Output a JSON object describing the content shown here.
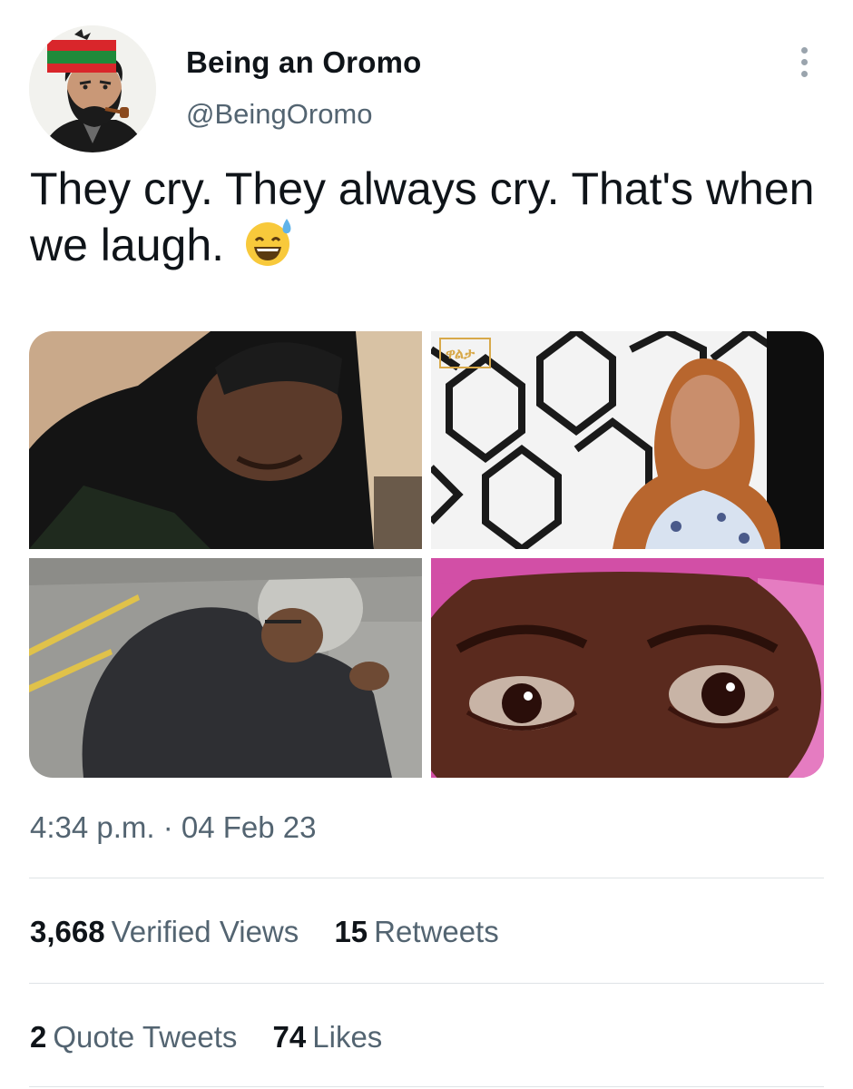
{
  "author": {
    "name": "Being an Oromo",
    "handle": "@BeingOromo"
  },
  "tweet": {
    "text": "They cry. They always cry. That's when we laugh.",
    "emoji": "grinning-face-with-sweat",
    "timestamp": "4:34 p.m. · 04 Feb 23"
  },
  "media": {
    "images": [
      {
        "description": "man crying, head bowed"
      },
      {
        "description": "woman tearful in studio"
      },
      {
        "description": "elderly man sitting on pavement covering his face"
      },
      {
        "description": "close-up of teary eyes"
      }
    ],
    "watermark_text": "ዋልታ"
  },
  "stats": {
    "views_count": "3,668",
    "views_label": "Verified Views",
    "retweets_count": "15",
    "retweets_label": "Retweets",
    "quotes_count": "2",
    "quotes_label": "Quote Tweets",
    "likes_count": "74",
    "likes_label": "Likes"
  },
  "colors": {
    "text_primary": "#0f1419",
    "text_secondary": "#536471",
    "divider": "#dfe3e6",
    "background": "#ffffff"
  }
}
